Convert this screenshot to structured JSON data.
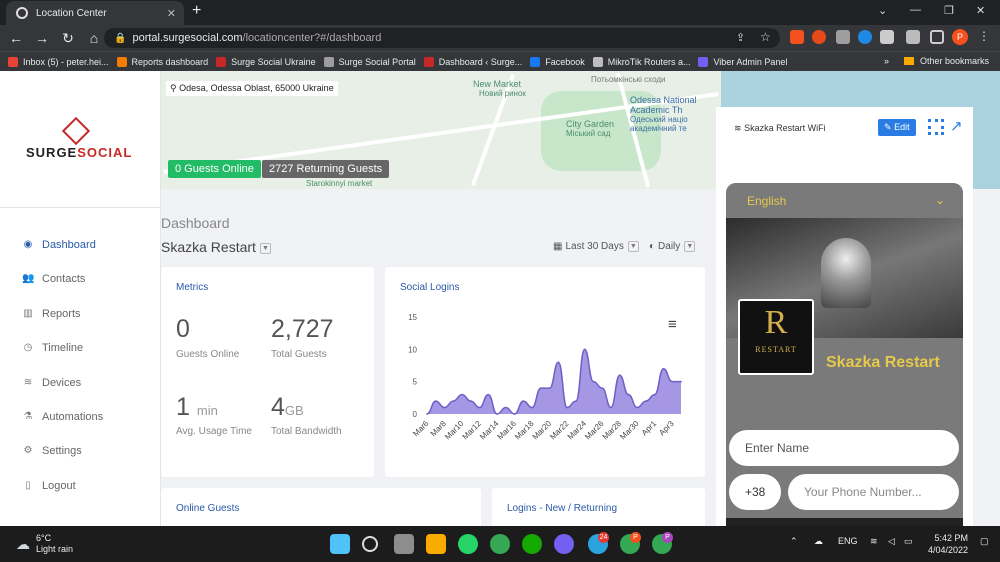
{
  "browser": {
    "tab_title": "Location Center",
    "new_tab": "+",
    "url_host": "portal.surgesocial.com",
    "url_path": "/locationcenter?#/dashboard",
    "profile_initial": "P",
    "win_min": "⌄",
    "win_min2": "—",
    "win_max": "❐",
    "win_close": "✕",
    "bookmarks": [
      {
        "label": "Inbox (5) - peter.hei...",
        "color": "#ea4335"
      },
      {
        "label": "Reports dashboard",
        "color": "#f57c00"
      },
      {
        "label": "Surge Social Ukraine",
        "color": "#c62828"
      },
      {
        "label": "Surge Social Portal",
        "color": "#9e9e9e"
      },
      {
        "label": "Dashboard ‹ Surge...",
        "color": "#c62828"
      },
      {
        "label": "Facebook",
        "color": "#1877f2"
      },
      {
        "label": "MikroTik Routers a...",
        "color": "#bdbdbd"
      },
      {
        "label": "Viber Admin Panel",
        "color": "#7360f2"
      }
    ],
    "bm_more": "»",
    "other_bookmarks": "Other bookmarks"
  },
  "sidebar": {
    "logo_a": "SURGE",
    "logo_b": "SOCIAL",
    "items": [
      {
        "label": "Dashboard",
        "icon": "dashboard-icon",
        "glyph": "◉"
      },
      {
        "label": "Contacts",
        "icon": "contacts-icon",
        "glyph": "👥"
      },
      {
        "label": "Reports",
        "icon": "reports-icon",
        "glyph": "▥"
      },
      {
        "label": "Timeline",
        "icon": "timeline-icon",
        "glyph": "◷"
      },
      {
        "label": "Devices",
        "icon": "wifi-icon",
        "glyph": "≋"
      },
      {
        "label": "Automations",
        "icon": "automations-icon",
        "glyph": "⚗"
      },
      {
        "label": "Settings",
        "icon": "gear-icon",
        "glyph": "⚙"
      },
      {
        "label": "Logout",
        "icon": "logout-icon",
        "glyph": "▯"
      }
    ]
  },
  "map": {
    "address": "Odesa, Odessa Oblast, 65000 Ukraine",
    "labels": [
      "New Market",
      "Новий ринок",
      "Odessa National",
      "Academic Th",
      "Одеський націо",
      "академічний те",
      "City Garden",
      "Міський сад",
      "Потьомкінські сходи",
      "Starokinnyi market"
    ]
  },
  "guests_online_btn": "0 Guests Online",
  "returning_btn": "2727 Returning Guests",
  "dashboard_label": "Dashboard",
  "location_name": "Skazka Restart",
  "range_label": "Last 30 Days",
  "interval_label": "Daily",
  "metrics": {
    "title": "Metrics",
    "guests_online": "0",
    "guests_online_label": "Guests Online",
    "total_guests": "2,727",
    "total_guests_label": "Total Guests",
    "avg_usage": "1",
    "avg_usage_unit": "min",
    "avg_usage_label": "Avg. Usage Time",
    "bandwidth": "4",
    "bandwidth_unit": "GB",
    "bandwidth_label": "Total Bandwidth"
  },
  "social": {
    "title": "Social Logins",
    "menu_icon": "≡",
    "chart_data": {
      "type": "area",
      "title": "Social Logins",
      "ylim": [
        0,
        15
      ],
      "yticks": [
        0,
        5,
        10,
        15
      ],
      "x": [
        "Mar6",
        "Mar7",
        "Mar8",
        "Mar9",
        "Mar10",
        "Mar11",
        "Mar12",
        "Mar13",
        "Mar14",
        "Mar15",
        "Mar16",
        "Mar17",
        "Mar18",
        "Mar19",
        "Mar20",
        "Mar21",
        "Mar22",
        "Mar23",
        "Mar24",
        "Mar25",
        "Mar26",
        "Mar27",
        "Mar28",
        "Mar29",
        "Mar30",
        "Mar31",
        "Apr1",
        "Apr2",
        "Apr3",
        "Apr4"
      ],
      "xticks": [
        "Mar6",
        "Mar8",
        "Mar10",
        "Mar12",
        "Mar14",
        "Mar16",
        "Mar18",
        "Mar20",
        "Mar22",
        "Mar24",
        "Mar26",
        "Mar28",
        "Mar30",
        "Apr1",
        "Apr3"
      ],
      "series": [
        {
          "values": [
            0,
            2,
            1,
            2,
            3,
            2,
            1,
            3,
            0,
            1,
            0,
            2,
            1,
            4,
            4,
            8,
            1,
            2,
            10,
            5,
            4,
            1,
            6,
            3,
            1,
            2,
            3,
            7,
            5,
            5
          ]
        }
      ],
      "color": "#9b8ce0"
    }
  },
  "online_guests_title": "Online Guests",
  "logins_title": "Logins - New / Returning",
  "right_panel": {
    "wifi_label": "Skazka Restart WiFi",
    "edit_label": "Edit",
    "language": "English",
    "brand_r": "R",
    "brand_sub": "RESTART",
    "brand_name": "Skazka Restart",
    "name_placeholder": "Enter Name",
    "country_code": "+38",
    "phone_placeholder": "Your Phone Number..."
  },
  "taskbar": {
    "temp": "6°C",
    "weather": "Light rain",
    "lang": "ENG",
    "time": "5:42 PM",
    "date": "4/04/2022",
    "telegram_badge": "24",
    "chrome_badge1": "P",
    "chrome_badge2": "P"
  }
}
